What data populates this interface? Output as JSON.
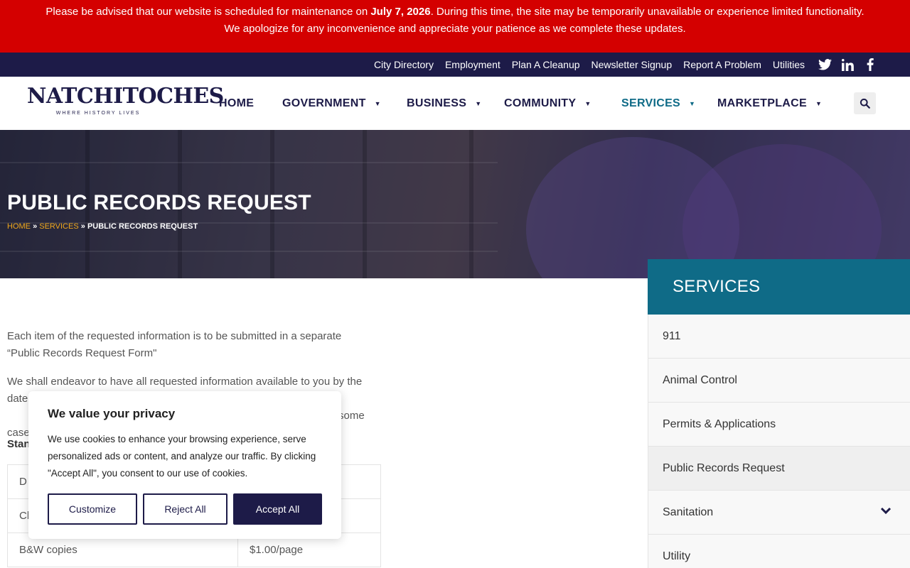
{
  "alert": {
    "line1_pre": "Please be advised that our website is scheduled for maintenance on ",
    "line1_date": "July 7, 2026",
    "line1_post": ". During this time, the site may be temporarily unavailable or experience limited functionality.",
    "line2": "We apologize for any inconvenience and appreciate your patience as we complete these updates."
  },
  "topbar": {
    "links": [
      "City Directory",
      "Employment",
      "Plan A Cleanup",
      "Newsletter Signup",
      "Report A Problem",
      "Utilities"
    ],
    "social_icons": [
      "twitter-icon",
      "linkedin-icon",
      "facebook-icon"
    ]
  },
  "logo": {
    "name": "NATCHITOCHES",
    "tagline": "WHERE HISTORY LIVES"
  },
  "nav": {
    "items": [
      {
        "label": "HOME"
      },
      {
        "label": "GOVERNMENT"
      },
      {
        "label": "BUSINESS"
      },
      {
        "label": "COMMUNITY"
      },
      {
        "label": "SERVICES"
      },
      {
        "label": "MARKETPLACE"
      }
    ],
    "active": "SERVICES"
  },
  "hero": {
    "title": "PUBLIC RECORDS REQUEST",
    "breadcrumb": {
      "home": "HOME",
      "sep": "»",
      "services": "SERVICES",
      "current": "PUBLIC RECORDS REQUEST"
    }
  },
  "content": {
    "para1": "Each item of the requested information is to be submitted in a separate “Public Records Request Form\"",
    "para2": "We shall endeavor to have all requested information available to you by the date",
    "para2_tail": "some",
    "para2_cont": "case",
    "label": "Stan",
    "table": [
      {
        "item": "D",
        "price": ""
      },
      {
        "item": "Cl",
        "price": ""
      },
      {
        "item": "B&W copies",
        "price": "$1.00/page"
      }
    ]
  },
  "sidebar": {
    "heading": "SERVICES",
    "items": [
      {
        "label": "911"
      },
      {
        "label": "Animal Control"
      },
      {
        "label": "Permits & Applications"
      },
      {
        "label": "Public Records Request"
      },
      {
        "label": "Sanitation"
      },
      {
        "label": "Utility"
      }
    ],
    "current": "Public Records Request"
  },
  "cookie": {
    "title": "We value your privacy",
    "body": "We use cookies to enhance your browsing experience, serve personalized ads or content, and analyze our traffic. By clicking \"Accept All\", you consent to our use of cookies.",
    "customize": "Customize",
    "reject": "Reject All",
    "accept": "Accept All"
  },
  "colors": {
    "alert_red": "#d40000",
    "navy": "#1d1b48",
    "teal": "#0f6b87",
    "gold": "#f0a81c"
  }
}
